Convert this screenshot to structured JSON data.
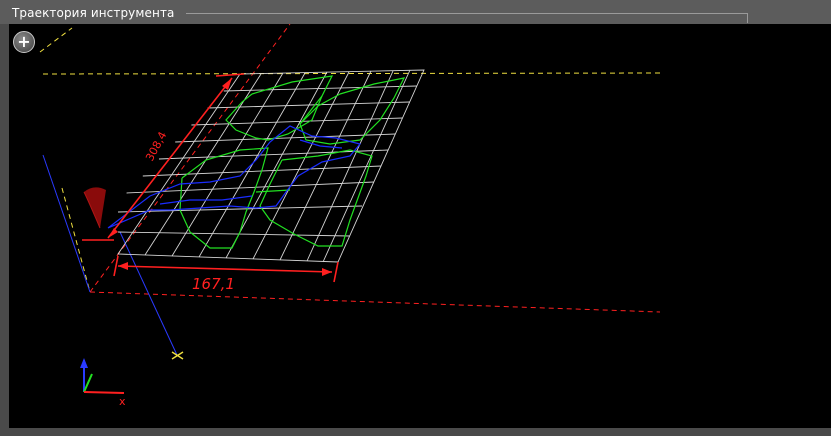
{
  "panel": {
    "title": "Траектория инструмента"
  },
  "toolbar": {
    "zoom_button_label": "+"
  },
  "dimensions": {
    "length_label": "308,4",
    "width_label": "167,1"
  },
  "axes": {
    "x_label": "x"
  },
  "colors": {
    "background": "#000000",
    "grid": "#e0e0e0",
    "toolpath_outline": "#22e022",
    "toolpath_inner": "#1a2cff",
    "dimension": "#ff2020",
    "guide": "#f0e040"
  }
}
